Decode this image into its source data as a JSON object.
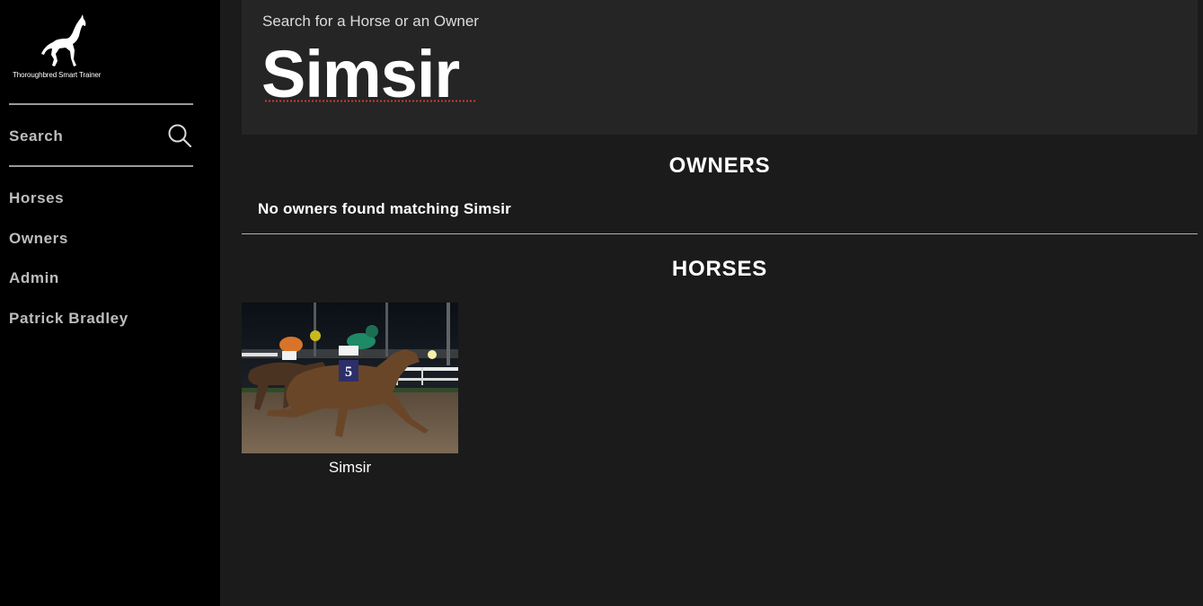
{
  "sidebar": {
    "logo_text": "Thoroughbred Smart Trainer",
    "search_label": "Search",
    "nav": [
      "Horses",
      "Owners",
      "Admin",
      "Patrick Bradley"
    ]
  },
  "header": {
    "subtitle": "Search for a Horse or an Owner",
    "query": "Simsir"
  },
  "owners": {
    "title": "OWNERS",
    "empty_message": "No owners found matching Simsir"
  },
  "horses": {
    "title": "HORSES",
    "results": [
      {
        "name": "Simsir",
        "saddle_number": "5"
      }
    ]
  }
}
